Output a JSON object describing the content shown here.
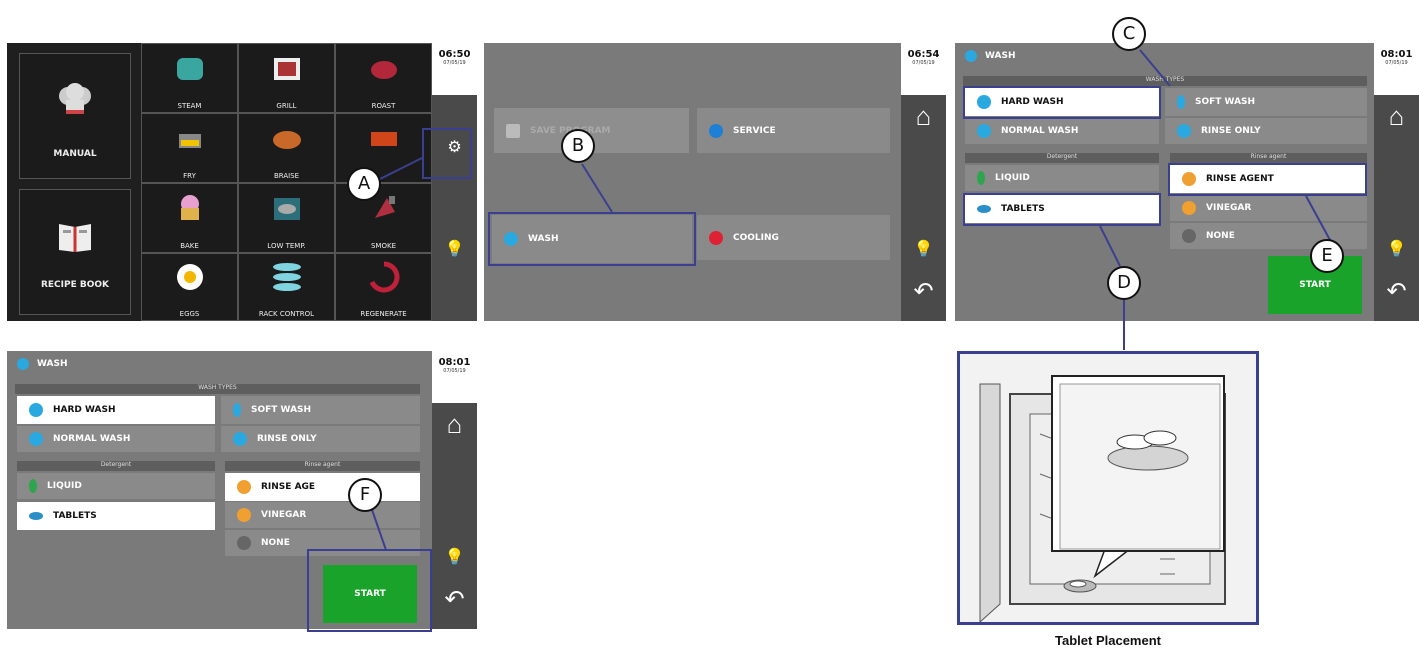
{
  "callouts": {
    "a": "A",
    "b": "B",
    "c": "C",
    "d": "D",
    "e": "E",
    "f": "F"
  },
  "screen1": {
    "time": "06:50",
    "date": "07/05/19",
    "manual": "MANUAL",
    "recipe": "RECIPE BOOK",
    "cells": [
      "STEAM",
      "GRILL",
      "ROAST",
      "FRY",
      "BRAISE",
      "",
      "BAKE",
      "LOW TEMP.",
      "SMOKE",
      "EGGS",
      "RACK CONTROL",
      "REGENERATE"
    ]
  },
  "screen2": {
    "time": "06:54",
    "date": "07/05/19",
    "program": "SAVE PROGRAM",
    "service": "SERVICE",
    "wash": "WASH",
    "cooling": "COOLING"
  },
  "screen3": {
    "time": "08:01",
    "date": "07/05/19",
    "title": "WASH",
    "wash_types": "WASH TYPES",
    "hard": "HARD WASH",
    "soft": "SOFT WASH",
    "normal": "NORMAL WASH",
    "rinse_only": "RINSE ONLY",
    "detergent": "Detergent",
    "liquid": "LIQUID",
    "tablets": "TABLETS",
    "rinse_agent_hdr": "Rinse agent",
    "rinse_agent": "RINSE AGENT",
    "vinegar": "VINEGAR",
    "none": "NONE",
    "start": "START"
  },
  "screen4": {
    "time": "08:01",
    "date": "07/05/19",
    "title": "WASH",
    "wash_types": "WASH TYPES",
    "hard": "HARD WASH",
    "soft": "SOFT WASH",
    "normal": "NORMAL WASH",
    "rinse_only": "RINSE ONLY",
    "detergent": "Detergent",
    "liquid": "LIQUID",
    "tablets": "TABLETS",
    "rinse_agent_hdr": "Rinse agent",
    "rinse_agent": "RINSE AGE",
    "vinegar": "VINEGAR",
    "none": "NONE",
    "start": "START"
  },
  "caption": "Tablet Placement",
  "colors": {
    "start": "#1aa32a",
    "highlight": "#3b3f8f",
    "sidebar": "#4a4a4a"
  }
}
